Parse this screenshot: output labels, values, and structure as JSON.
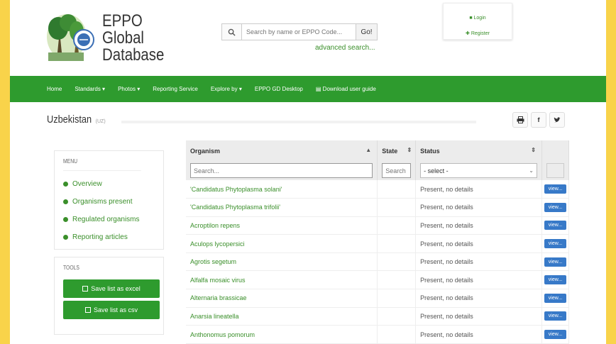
{
  "brand": {
    "line1": "EPPO",
    "line2": "Global",
    "line3": "Database"
  },
  "search": {
    "placeholder": "Search by name or EPPO Code...",
    "go_label": "Go!",
    "advanced_label": "advanced search..."
  },
  "account": {
    "login_label": "Login",
    "register_label": "Register"
  },
  "nav": {
    "items": [
      "Home",
      "Standards ▾",
      "Photos ▾",
      "Reporting Service",
      "Explore by ▾",
      "EPPO GD Desktop",
      "Download user guide"
    ]
  },
  "page": {
    "title": "Uzbekistan",
    "code": "(UZ)"
  },
  "menu": {
    "title": "MENU",
    "items": [
      "Overview",
      "Organisms present",
      "Regulated organisms",
      "Reporting articles"
    ]
  },
  "tools": {
    "title": "TOOLS",
    "excel_label": "Save list as excel",
    "csv_label": "Save list as csv"
  },
  "table": {
    "headers": {
      "organism": "Organism",
      "state": "State",
      "status": "Status"
    },
    "filters": {
      "organism_placeholder": "Search...",
      "state_placeholder": "Search",
      "status_selected": "- select -"
    },
    "view_label": "view...",
    "rows": [
      {
        "organism": "'Candidatus Phytoplasma solani'",
        "status": "Present, no details"
      },
      {
        "organism": "'Candidatus Phytoplasma trifolii'",
        "status": "Present, no details"
      },
      {
        "organism": "Acroptilon repens",
        "status": "Present, no details"
      },
      {
        "organism": "Aculops lycopersici",
        "status": "Present, no details"
      },
      {
        "organism": "Agrotis segetum",
        "status": "Present, no details"
      },
      {
        "organism": "Alfalfa mosaic virus",
        "status": "Present, no details"
      },
      {
        "organism": "Alternaria brassicae",
        "status": "Present, no details"
      },
      {
        "organism": "Anarsia lineatella",
        "status": "Present, no details"
      },
      {
        "organism": "Anthonomus pomorum",
        "status": "Present, no details"
      }
    ]
  },
  "colors": {
    "accent_green": "#2e9b2e",
    "link_green": "#3a8f2a",
    "view_button_blue": "#3779c8",
    "background_yellow": "#f9d34a"
  },
  "icons": {
    "search": "search-icon",
    "print": "print-icon",
    "facebook": "facebook-icon",
    "twitter": "twitter-icon",
    "user": "user-icon",
    "register": "register-icon",
    "document": "document-icon"
  }
}
